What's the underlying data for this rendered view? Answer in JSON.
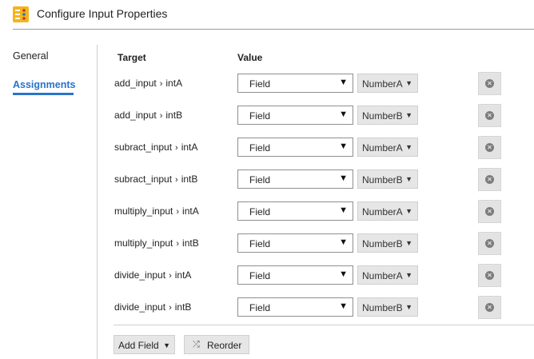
{
  "header": {
    "title": "Configure Input Properties"
  },
  "nav": {
    "general": "General",
    "assignments": "Assignments"
  },
  "columns": {
    "target": "Target",
    "value": "Value"
  },
  "separator": "›",
  "rows": [
    {
      "target_a": "add_input",
      "target_b": "intA",
      "type": "Field",
      "value": "NumberA"
    },
    {
      "target_a": "add_input",
      "target_b": "intB",
      "type": "Field",
      "value": "NumberB"
    },
    {
      "target_a": "subract_input",
      "target_b": "intA",
      "type": "Field",
      "value": "NumberA"
    },
    {
      "target_a": "subract_input",
      "target_b": "intB",
      "type": "Field",
      "value": "NumberB"
    },
    {
      "target_a": "multiply_input",
      "target_b": "intA",
      "type": "Field",
      "value": "NumberA"
    },
    {
      "target_a": "multiply_input",
      "target_b": "intB",
      "type": "Field",
      "value": "NumberB"
    },
    {
      "target_a": "divide_input",
      "target_b": "intA",
      "type": "Field",
      "value": "NumberA"
    },
    {
      "target_a": "divide_input",
      "target_b": "intB",
      "type": "Field",
      "value": "NumberB"
    }
  ],
  "footer": {
    "add_field_label": "Add Field",
    "reorder_label": "Reorder"
  },
  "icons": {
    "app": "configure-properties-icon",
    "dropdown": "chevron-down-icon",
    "remove": "remove-circle-icon",
    "reorder": "shuffle-icon"
  },
  "colors": {
    "accent": "#2a73c9",
    "app_icon": "#f2b51c"
  }
}
